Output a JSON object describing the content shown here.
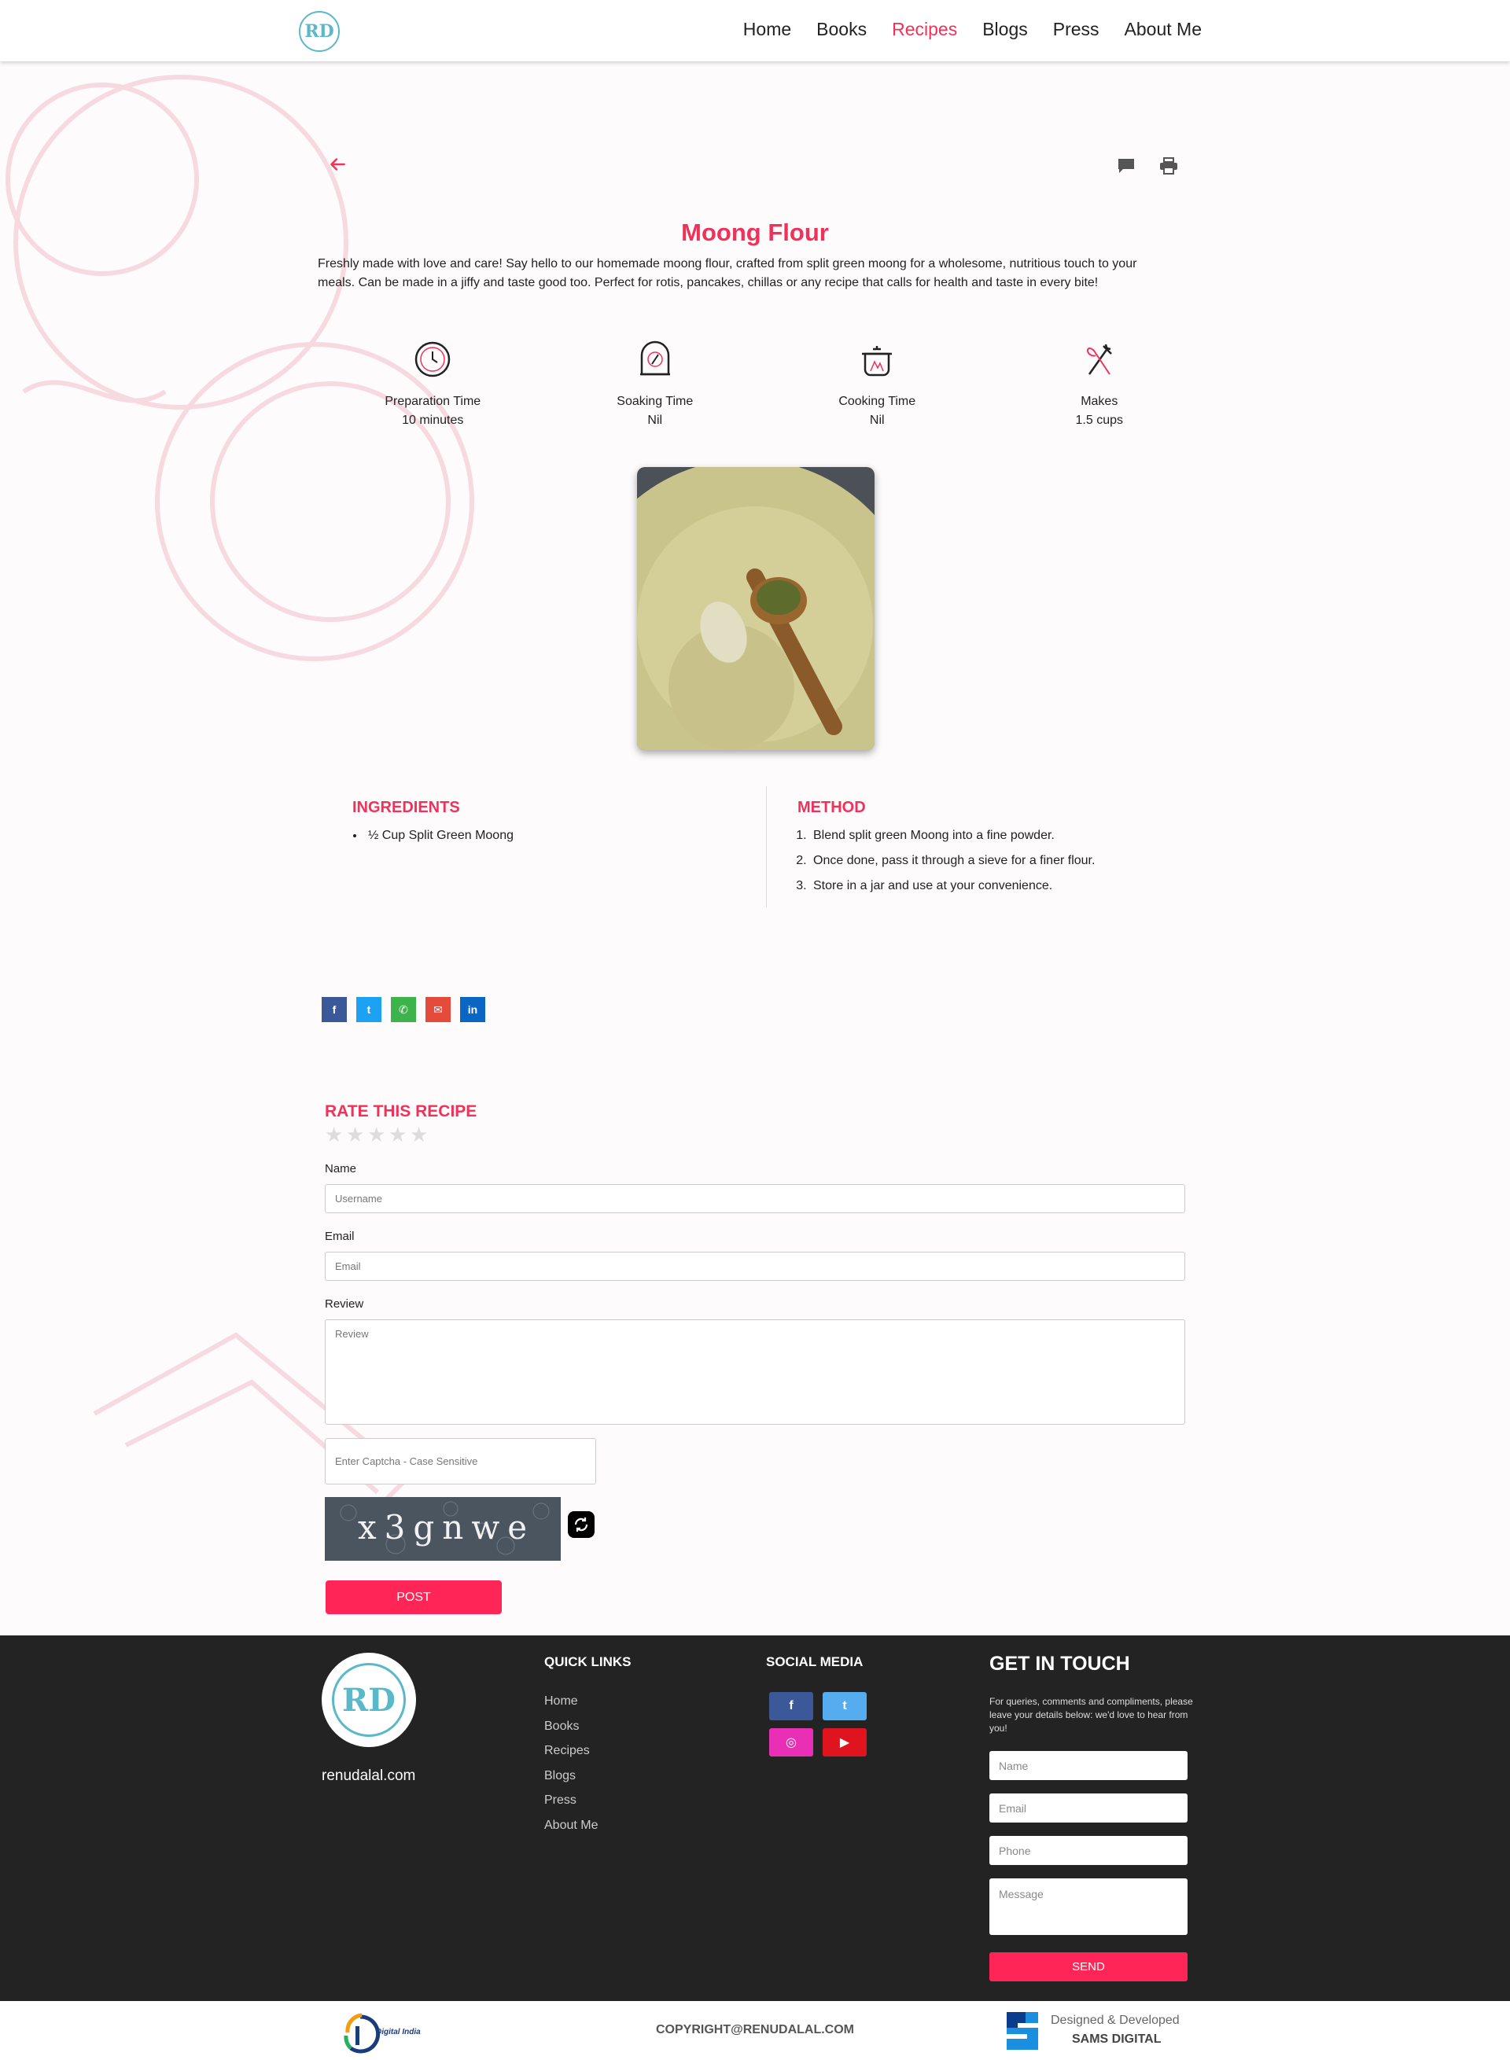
{
  "header": {
    "logo_text": "RD",
    "nav": [
      {
        "label": "Home",
        "active": false
      },
      {
        "label": "Books",
        "active": false
      },
      {
        "label": "Recipes",
        "active": true
      },
      {
        "label": "Blogs",
        "active": false
      },
      {
        "label": "Press",
        "active": false
      },
      {
        "label": "About Me",
        "active": false
      }
    ]
  },
  "recipe": {
    "title": "Moong Flour",
    "description": "Freshly made with love and care! Say hello to our homemade moong flour, crafted from split green moong for a wholesome, nutritious touch to your meals. Can be made in a jiffy and taste good too. Perfect for rotis, pancakes, chillas or any recipe that calls for health and taste in every bite!",
    "stats": [
      {
        "icon": "clock-icon",
        "label": "Preparation Time",
        "value": "10 minutes"
      },
      {
        "icon": "soaking-bowl-icon",
        "label": "Soaking Time",
        "value": "Nil"
      },
      {
        "icon": "cooking-pot-icon",
        "label": "Cooking Time",
        "value": "Nil"
      },
      {
        "icon": "utensils-icon",
        "label": "Makes",
        "value": "1.5 cups"
      }
    ],
    "ingredients_heading": "INGREDIENTS",
    "ingredients": [
      "½ Cup Split Green Moong"
    ],
    "method_heading": "METHOD",
    "method": [
      "Blend split green Moong into a fine powder.",
      "Once done, pass it through a sieve for a finer flour.",
      "Store in a jar and use at your convenience."
    ]
  },
  "share": [
    "facebook-icon",
    "twitter-icon",
    "whatsapp-icon",
    "email-icon",
    "linkedin-icon"
  ],
  "review_form": {
    "heading": "RATE THIS RECIPE",
    "rating": 0,
    "name_label": "Name",
    "name_placeholder": "Username",
    "email_label": "Email",
    "email_placeholder": "Email",
    "review_label": "Review",
    "review_placeholder": "Review",
    "captcha_placeholder": "Enter Captcha - Case Sensitive",
    "captcha_text": "x3gnwe",
    "post_label": "POST"
  },
  "footer": {
    "logo_text": "RD",
    "site": "renudalal.com",
    "quick_links_heading": "QUICK LINKS",
    "quick_links": [
      "Home",
      "Books",
      "Recipes",
      "Blogs",
      "Press",
      "About Me"
    ],
    "social_heading": "SOCIAL MEDIA",
    "social": [
      {
        "icon": "facebook-icon",
        "glyph": "f",
        "color": "#3b5998"
      },
      {
        "icon": "twitter-icon",
        "glyph": "t",
        "color": "#55acee"
      },
      {
        "icon": "instagram-icon",
        "glyph": "◎",
        "color": "#e92fb5"
      },
      {
        "icon": "youtube-icon",
        "glyph": "▶",
        "color": "#e0141e"
      }
    ],
    "get_in_touch_heading": "GET IN TOUCH",
    "get_in_touch_text": "For queries, comments and compliments, please leave your details below: we'd love to hear from you!",
    "name_placeholder": "Name",
    "email_placeholder": "Email",
    "phone_placeholder": "Phone",
    "message_placeholder": "Message",
    "send_label": "SEND"
  },
  "bottom_bar": {
    "digital_india": "Digital India",
    "copyright": "COPYRIGHT@RENUDALAL.COM",
    "designed_by_line1": "Designed & Developed",
    "designed_by_line2": "SAMS DIGITAL"
  },
  "colors": {
    "accent": "#f0325a",
    "button": "#ff2657",
    "footer_bg": "#232323",
    "logo_teal": "#5bb8c9"
  }
}
